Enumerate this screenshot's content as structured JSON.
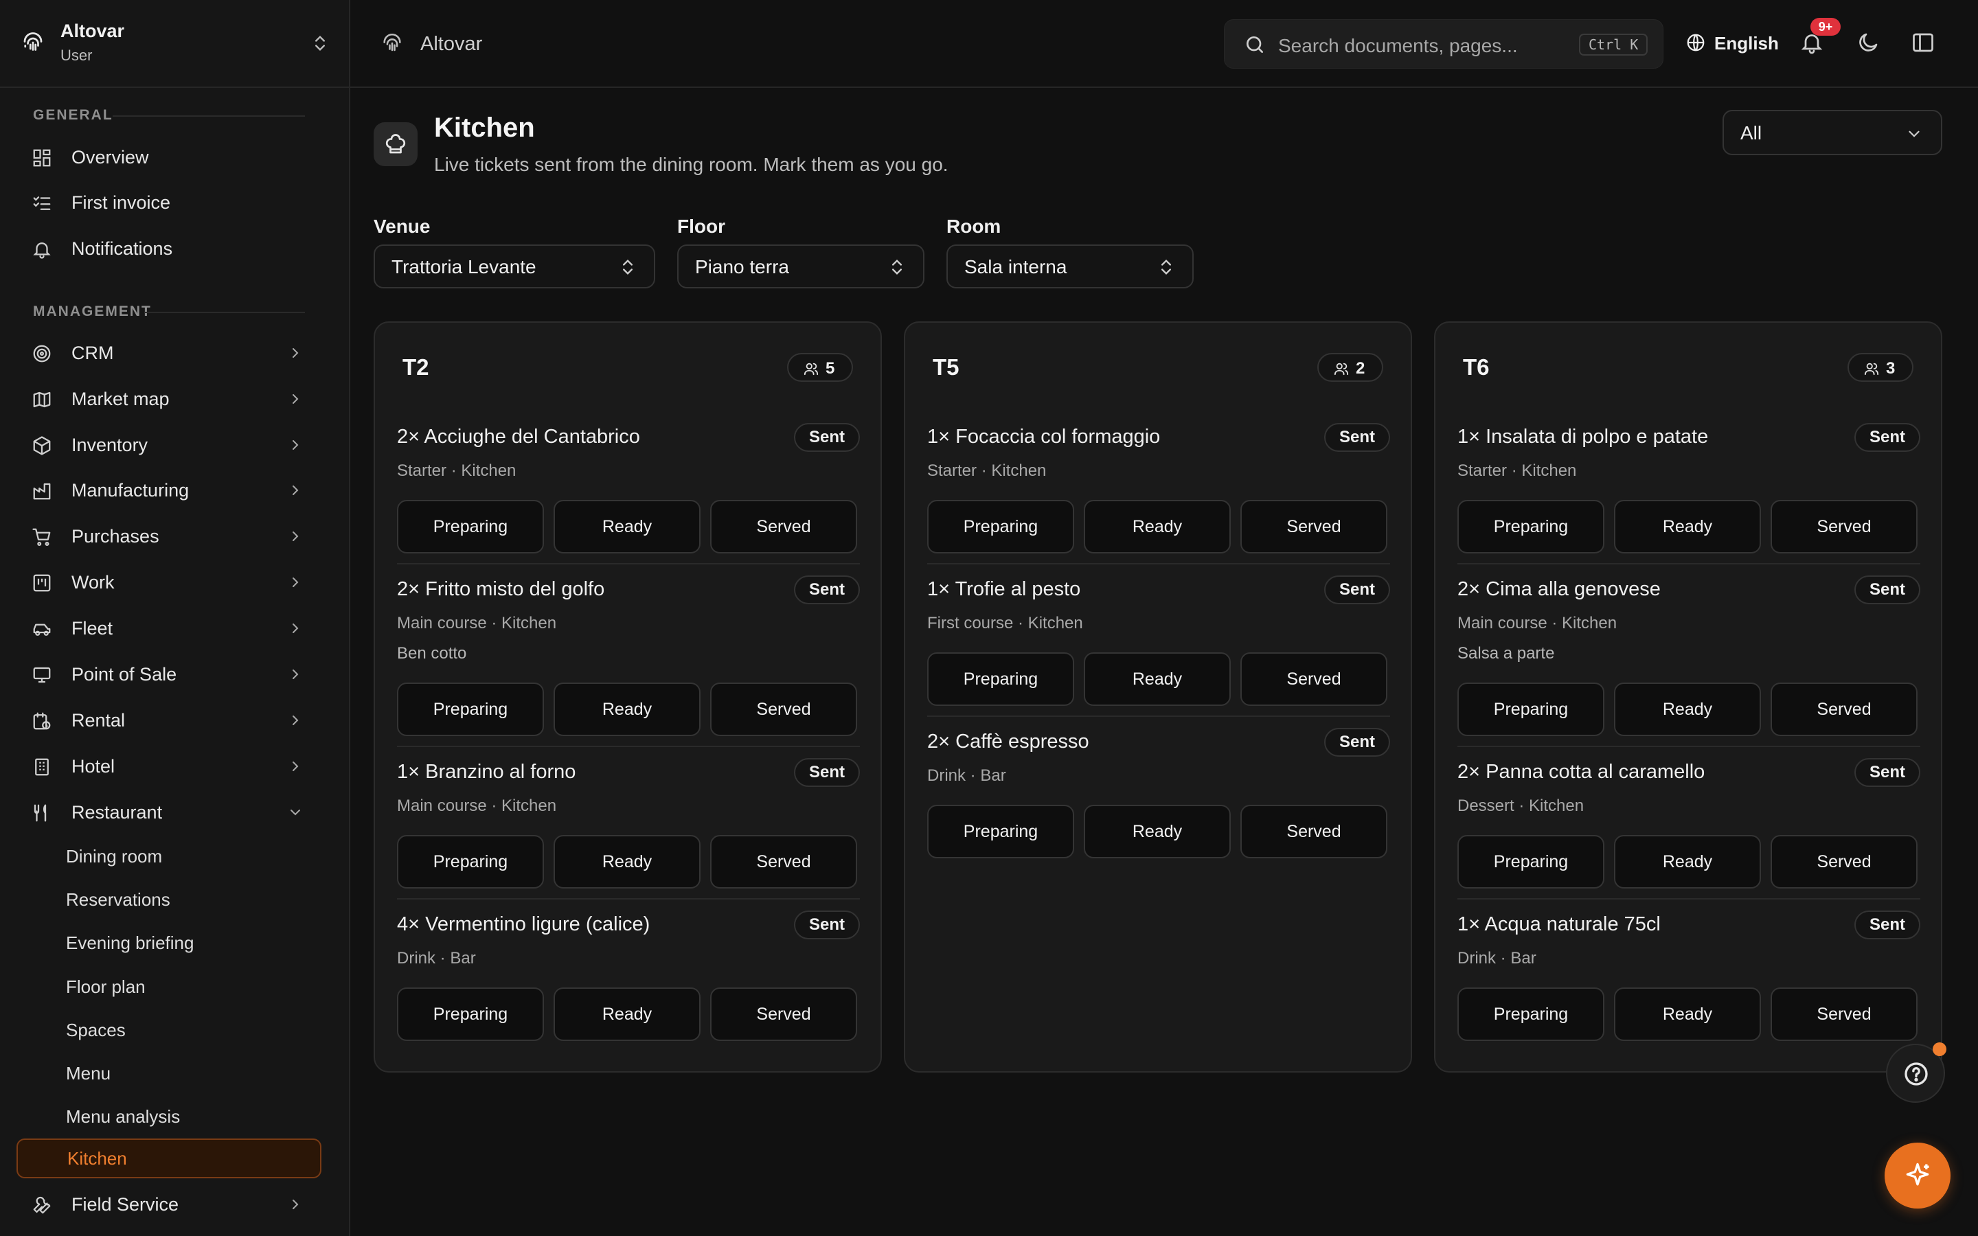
{
  "workspace": {
    "name": "Altovar",
    "role": "User"
  },
  "sidebar": {
    "sections": [
      {
        "label": "GENERAL"
      },
      {
        "label": "MANAGEMENT"
      }
    ],
    "general": [
      {
        "label": "Overview",
        "icon": "dashboard-icon"
      },
      {
        "label": "First invoice",
        "icon": "checklist-icon"
      },
      {
        "label": "Notifications",
        "icon": "bell-icon"
      }
    ],
    "management": [
      {
        "label": "CRM",
        "icon": "target-icon"
      },
      {
        "label": "Market map",
        "icon": "map-icon"
      },
      {
        "label": "Inventory",
        "icon": "box-icon"
      },
      {
        "label": "Manufacturing",
        "icon": "factory-icon"
      },
      {
        "label": "Purchases",
        "icon": "cart-icon"
      },
      {
        "label": "Work",
        "icon": "kanban-icon"
      },
      {
        "label": "Fleet",
        "icon": "car-icon"
      },
      {
        "label": "Point of Sale",
        "icon": "monitor-icon"
      },
      {
        "label": "Rental",
        "icon": "calendar-clock-icon"
      },
      {
        "label": "Hotel",
        "icon": "building-icon"
      },
      {
        "label": "Restaurant",
        "icon": "utensils-icon"
      }
    ],
    "restaurant_sub": [
      {
        "label": "Dining room"
      },
      {
        "label": "Reservations"
      },
      {
        "label": "Evening briefing"
      },
      {
        "label": "Floor plan"
      },
      {
        "label": "Spaces"
      },
      {
        "label": "Menu"
      },
      {
        "label": "Menu analysis"
      },
      {
        "label": "Kitchen",
        "active": true
      }
    ],
    "after": [
      {
        "label": "Field Service",
        "icon": "wrench-icon"
      }
    ]
  },
  "topbar": {
    "breadcrumb": "Altovar",
    "search_placeholder": "Search documents, pages...",
    "shortcut": "Ctrl K",
    "language": "English",
    "notification_badge": "9+"
  },
  "page": {
    "title": "Kitchen",
    "subtitle": "Live tickets sent from the dining room. Mark them as you go.",
    "filter_select": "All"
  },
  "filters": {
    "venue": {
      "label": "Venue",
      "value": "Trattoria Levante"
    },
    "floor": {
      "label": "Floor",
      "value": "Piano terra"
    },
    "room": {
      "label": "Room",
      "value": "Sala interna"
    }
  },
  "actions": {
    "preparing": "Preparing",
    "ready": "Ready",
    "served": "Served"
  },
  "tables": [
    {
      "name": "T2",
      "guests": "5",
      "items": [
        {
          "name": "2× Acciughe del Cantabrico",
          "meta": "Starter · Kitchen",
          "note": "",
          "status": "Sent"
        },
        {
          "name": "2× Fritto misto del golfo",
          "meta": "Main course · Kitchen",
          "note": "Ben cotto",
          "status": "Sent"
        },
        {
          "name": "1× Branzino al forno",
          "meta": "Main course · Kitchen",
          "note": "",
          "status": "Sent"
        },
        {
          "name": "4× Vermentino ligure (calice)",
          "meta": "Drink · Bar",
          "note": "",
          "status": "Sent"
        }
      ]
    },
    {
      "name": "T5",
      "guests": "2",
      "items": [
        {
          "name": "1× Focaccia col formaggio",
          "meta": "Starter · Kitchen",
          "note": "",
          "status": "Sent"
        },
        {
          "name": "1× Trofie al pesto",
          "meta": "First course · Kitchen",
          "note": "",
          "status": "Sent"
        },
        {
          "name": "2× Caffè espresso",
          "meta": "Drink · Bar",
          "note": "",
          "status": "Sent"
        }
      ]
    },
    {
      "name": "T6",
      "guests": "3",
      "items": [
        {
          "name": "1× Insalata di polpo e patate",
          "meta": "Starter · Kitchen",
          "note": "",
          "status": "Sent"
        },
        {
          "name": "2× Cima alla genovese",
          "meta": "Main course · Kitchen",
          "note": "Salsa a parte",
          "status": "Sent"
        },
        {
          "name": "2× Panna cotta al caramello",
          "meta": "Dessert · Kitchen",
          "note": "",
          "status": "Sent"
        },
        {
          "name": "1× Acqua naturale 75cl",
          "meta": "Drink · Bar",
          "note": "",
          "status": "Sent"
        }
      ]
    }
  ],
  "colors": {
    "accent": "#e8701f",
    "background": "#111111",
    "card": "#1a1a1a"
  }
}
